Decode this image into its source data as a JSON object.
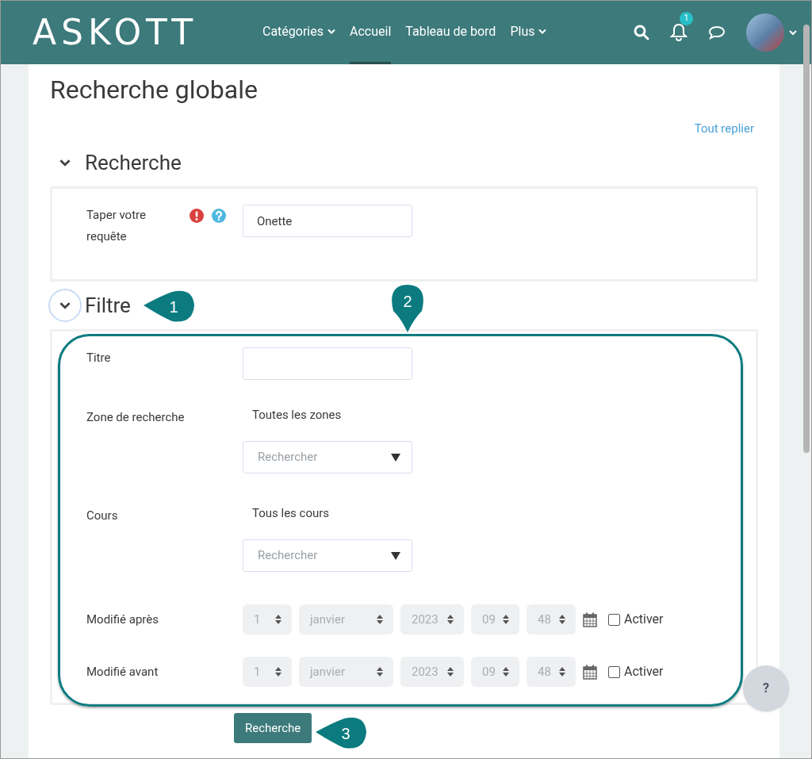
{
  "header": {
    "logo": "ASKOTT",
    "nav": [
      {
        "label": "Catégories",
        "dropdown": true,
        "selected": false
      },
      {
        "label": "Accueil",
        "dropdown": false,
        "selected": true
      },
      {
        "label": "Tableau de bord",
        "dropdown": false,
        "selected": false
      },
      {
        "label": "Plus",
        "dropdown": true,
        "selected": false
      }
    ],
    "notification_count": "1"
  },
  "page_title": "Recherche globale",
  "collapse_link": "Tout replier",
  "sections": [
    {
      "title": "Recherche",
      "expanded": true,
      "focused": false,
      "fields": [
        {
          "kind": "text",
          "label": "Taper votre requête",
          "required": true,
          "help": true,
          "value": "Onette"
        }
      ]
    },
    {
      "title": "Filtre",
      "expanded": true,
      "focused": true,
      "fields": [
        {
          "kind": "text",
          "label": "Titre",
          "required": false,
          "help": false
        },
        {
          "kind": "autocomplete",
          "label": "Zone de recherche",
          "selection": "Toutes les zones",
          "placeholder": "Rechercher"
        },
        {
          "kind": "autocomplete",
          "label": "Cours",
          "selection": "Tous les cours",
          "placeholder": "Rechercher"
        },
        {
          "kind": "datetime",
          "label": "Modifié après",
          "parts": [
            "1",
            "janvier",
            "2023",
            "09",
            "48"
          ],
          "checkbox_label": "Activer",
          "checked": false
        },
        {
          "kind": "datetime",
          "label": "Modifié avant",
          "parts": [
            "1",
            "janvier",
            "2023",
            "09",
            "48"
          ],
          "checkbox_label": "Activer",
          "checked": false
        }
      ]
    }
  ],
  "submit_button": "Recherche",
  "help_button": "?",
  "annotations": [
    {
      "number": "1",
      "kind": "left"
    },
    {
      "number": "2",
      "kind": "down"
    },
    {
      "number": "3",
      "kind": "left"
    }
  ]
}
